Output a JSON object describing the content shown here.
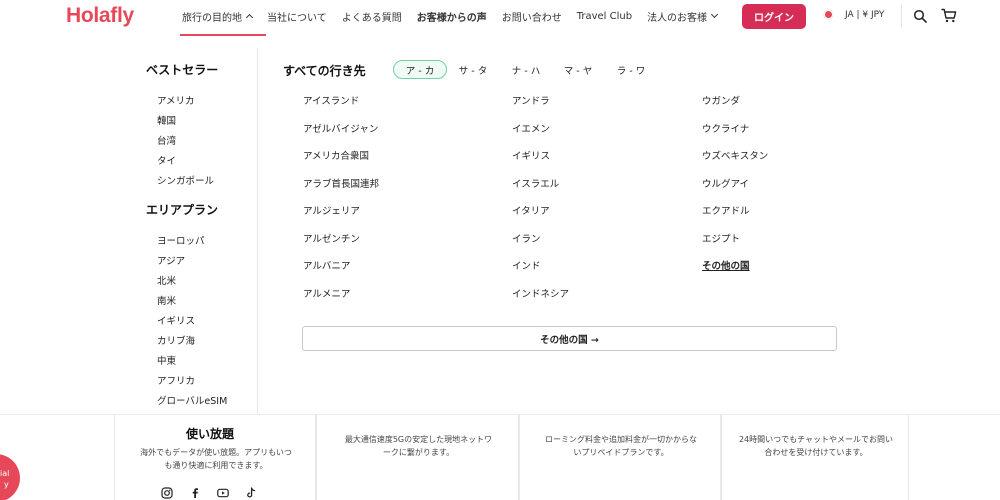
{
  "header": {
    "logo": "Holafly",
    "nav": [
      {
        "label": "旅行の目的地"
      },
      {
        "label": "当社について"
      },
      {
        "label": "よくある質問"
      },
      {
        "label": "お客様からの声"
      },
      {
        "label": "お問い合わせ"
      },
      {
        "label": "Travel Club"
      },
      {
        "label": "法人のお客様"
      }
    ],
    "login": "ログイン",
    "locale": "JA | ¥ JPY",
    "accent_color": "#d62d56",
    "icons": [
      "search-icon",
      "cart-icon",
      "chevron-up-icon",
      "chevron-down-icon"
    ]
  },
  "dropdown": {
    "bestsellers": {
      "title": "ベストセラー",
      "items": [
        "アメリカ",
        "韓国",
        "台湾",
        "タイ",
        "シンガポール"
      ]
    },
    "area_plans": {
      "title": "エリアプラン",
      "items": [
        "ヨーロッパ",
        "アジア",
        "北米",
        "南米",
        "イギリス",
        "カリブ海",
        "中東",
        "アフリカ",
        "グローバルeSIM"
      ]
    },
    "all_destinations": {
      "title": "すべての行き先",
      "tabs": [
        "ア - カ",
        "サ - タ",
        "ナ - ハ",
        "マ - ヤ",
        "ラ - ワ"
      ],
      "active_tab": "ア - カ",
      "columns": [
        [
          "アイスランド",
          "アゼルバイジャン",
          "アメリカ合衆国",
          "アラブ首長国連邦",
          "アルジェリア",
          "アルゼンチン",
          "アルバニア",
          "アルメニア"
        ],
        [
          "アンドラ",
          "イエメン",
          "イギリス",
          "イスラエル",
          "イタリア",
          "イラン",
          "インド",
          "インドネシア"
        ],
        [
          "ウガンダ",
          "ウクライナ",
          "ウズベキスタン",
          "ウルグアイ",
          "エクアドル",
          "エジプト",
          "その他の国"
        ]
      ],
      "more_button": "その他の国 →",
      "tab_active_color": "#6fd3a0"
    }
  },
  "background_page": {
    "cards": [
      {
        "title": "使い放題",
        "text": [
          "海外でもデータが使い放題。アプリもいつ",
          "も通り快適に利用できます。"
        ]
      },
      {
        "title": "",
        "text": [
          "最大通信速度5Gの安定した現地ネットワ",
          "ークに繋がります。"
        ]
      },
      {
        "title": "",
        "text": [
          "ローミング料金や追加料金が一切かからな",
          "いプリペイドプランです。"
        ]
      },
      {
        "title": "",
        "text": [
          "24時間いつでもチャットやメールでお問い",
          "合わせを受け付けています。"
        ]
      }
    ],
    "social_icons": [
      "instagram-icon",
      "facebook-icon",
      "youtube-icon",
      "tiktok-icon"
    ],
    "fab_label": [
      "ial",
      "y"
    ]
  }
}
